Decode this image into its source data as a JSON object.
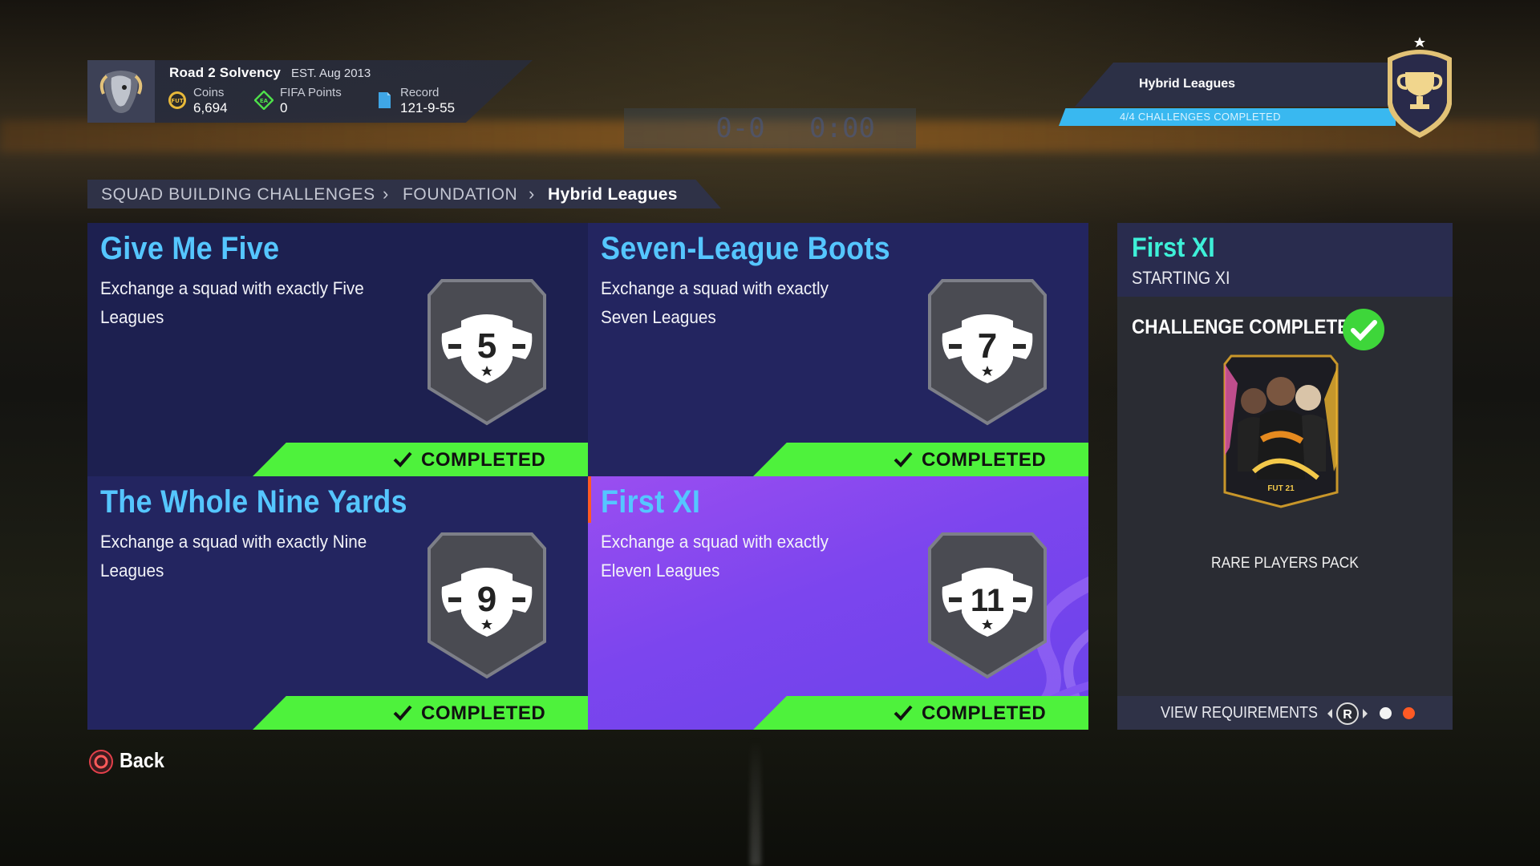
{
  "profile": {
    "club_name": "Road 2 Solvency",
    "established": "EST. Aug 2013",
    "coins": {
      "label": "Coins",
      "value": "6,694"
    },
    "fifa_points": {
      "label": "FIFA Points",
      "value": "0"
    },
    "record": {
      "label": "Record",
      "value": "121-9-55"
    }
  },
  "set": {
    "name": "Hybrid Leagues",
    "progress_text": "4/4 CHALLENGES COMPLETED"
  },
  "breadcrumb": {
    "items": [
      "SQUAD BUILDING CHALLENGES",
      "FOUNDATION"
    ],
    "current": "Hybrid Leagues"
  },
  "challenges": [
    {
      "title": "Give Me Five",
      "description": "Exchange a squad with exactly Five Leagues",
      "badge_number": "5",
      "status": "COMPLETED"
    },
    {
      "title": "Seven-League Boots",
      "description": "Exchange a squad with exactly Seven Leagues",
      "badge_number": "7",
      "status": "COMPLETED"
    },
    {
      "title": "The Whole Nine Yards",
      "description": "Exchange a squad with exactly Nine Leagues",
      "badge_number": "9",
      "status": "COMPLETED"
    },
    {
      "title": "First XI",
      "description": "Exchange a squad with exactly Eleven Leagues",
      "badge_number": "11",
      "status": "COMPLETED"
    }
  ],
  "detail": {
    "title": "First XI",
    "subtitle": "STARTING XI",
    "completed_text": "CHALLENGE COMPLETED",
    "reward": "RARE PLAYERS PACK",
    "pack_logo": "FUT 21",
    "view_requirements": "VIEW REQUIREMENTS",
    "stick_label": "R"
  },
  "back_label": "Back",
  "scoreboard": {
    "score": "0-0",
    "time": "0:00"
  },
  "colors": {
    "title_blue": "#55c6ff",
    "completed_green": "#4ef23c",
    "selected_purple": "#8a4af0",
    "progress_blue": "#39b8f0",
    "panel_title_teal": "#3ef0d8",
    "dot_active": "#ff5a24"
  },
  "icons": [
    "coins-icon",
    "fifa-points-icon",
    "record-icon",
    "trophy-icon",
    "check-icon",
    "circle-button-icon",
    "right-stick-icon"
  ]
}
